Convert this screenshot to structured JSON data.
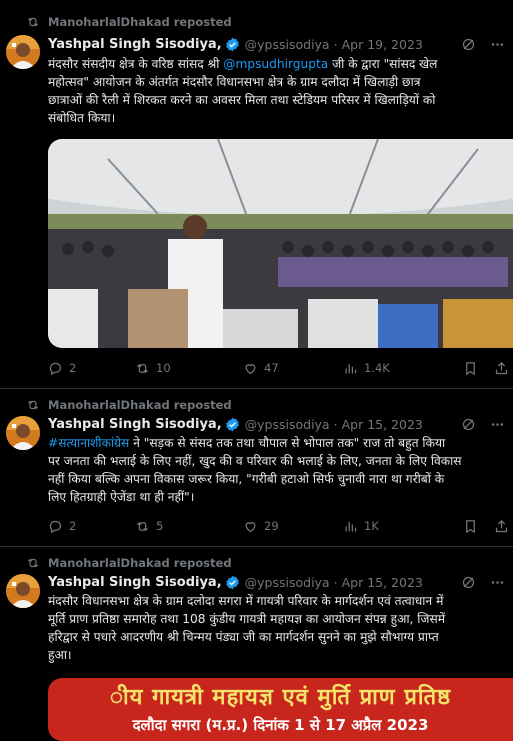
{
  "tweets": [
    {
      "repost_label": "ManoharlalDhakad reposted",
      "author_name": "Yashpal Singh Sisodiya,",
      "handle": "@ypssisodiya",
      "date": "Apr 19, 2023",
      "text_lines": [
        {
          "pre": "मंदसौर संसदीय क्षेत्र के वरिष्ठ सांसद श्री ",
          "link": "@mpsudhirgupta",
          "post": " जी के द्वारा \"सांसद खेल"
        },
        {
          "pre": "महोत्सव\" आयोजन के अंतर्गत मंदसौर विधानसभा क्षेत्र के ग्राम दलौदा में खिलाड़ी छात्र",
          "link": "",
          "post": ""
        },
        {
          "pre": "छात्राओं की रैली में शिरकत करने का अवसर मिला तथा स्टेडियम परिसर में खिलाड़ियों को",
          "link": "",
          "post": ""
        },
        {
          "pre": "संबोधित किया।",
          "link": "",
          "post": ""
        }
      ],
      "stats": {
        "replies": "2",
        "reposts": "10",
        "likes": "47",
        "views": "1.4K"
      }
    },
    {
      "repost_label": "ManoharlalDhakad reposted",
      "author_name": "Yashpal Singh Sisodiya,",
      "handle": "@ypssisodiya",
      "date": "Apr 15, 2023",
      "text_lines": [
        {
          "pre": "",
          "link": "#सत्यानाशीकांग्रेस",
          "post": " ने \"सड़क से संसद  तक तथा चौपाल से भोपाल तक\"  राज तो बहुत किया"
        },
        {
          "pre": "पर जनता की भलाई के लिए नहीं, खुद की व परिवार की भलाई के लिए, जनता के लिए विकास",
          "link": "",
          "post": ""
        },
        {
          "pre": "नहीं किया बल्कि अपना विकास जरूर किया, \"गरीबी हटाओ सिर्फ चुनावी नारा था गरीबों के",
          "link": "",
          "post": ""
        },
        {
          "pre": "लिए हितग्राही ऐजेंडा था ही नहीं\"।",
          "link": "",
          "post": ""
        }
      ],
      "stats": {
        "replies": "2",
        "reposts": "5",
        "likes": "29",
        "views": "1K"
      }
    },
    {
      "repost_label": "ManoharlalDhakad reposted",
      "author_name": "Yashpal Singh Sisodiya,",
      "handle": "@ypssisodiya",
      "date": "Apr 15, 2023",
      "text_lines": [
        {
          "pre": "मंदसौर विधानसभा क्षेत्र के ग्राम दलोदा सगरा में गायत्री परिवार के मार्गदर्शन एवं तत्वाधान में",
          "link": "",
          "post": ""
        },
        {
          "pre": "मूर्ति प्राण प्रतिष्ठा समारोह तथा 108 कुंडीय गायत्री महायज्ञ का आयोजन संपन्न हुआ, जिसमें",
          "link": "",
          "post": ""
        },
        {
          "pre": "हरिद्वार से पधारे आदरणीय श्री चिन्मय पंड्या जी का मार्गदर्शन सुनने का मुझे सौभाग्य प्राप्त",
          "link": "",
          "post": ""
        },
        {
          "pre": "हुआ।",
          "link": "",
          "post": ""
        }
      ],
      "banner_line1": "ीय गायत्री महायज्ञ एवं मुर्ति प्राण प्रतिष्ठ",
      "banner_line2": "दलौदा सगरा (म.प्र.) दिनांक 1 से 17 अप्रैल 2023"
    }
  ],
  "colors": {
    "background": "#000000",
    "text": "#e7e9ea",
    "muted": "#71767b",
    "link": "#1d9bf0",
    "verified": "#1d9bf0",
    "divider": "#2f3336",
    "banner_red": "#c8251c",
    "banner_yellow": "#f3e36a"
  },
  "icons": [
    "repost-icon",
    "verified-badge-icon",
    "grok-icon",
    "more-icon",
    "reply-icon",
    "like-icon",
    "views-icon",
    "bookmark-icon",
    "share-icon"
  ]
}
